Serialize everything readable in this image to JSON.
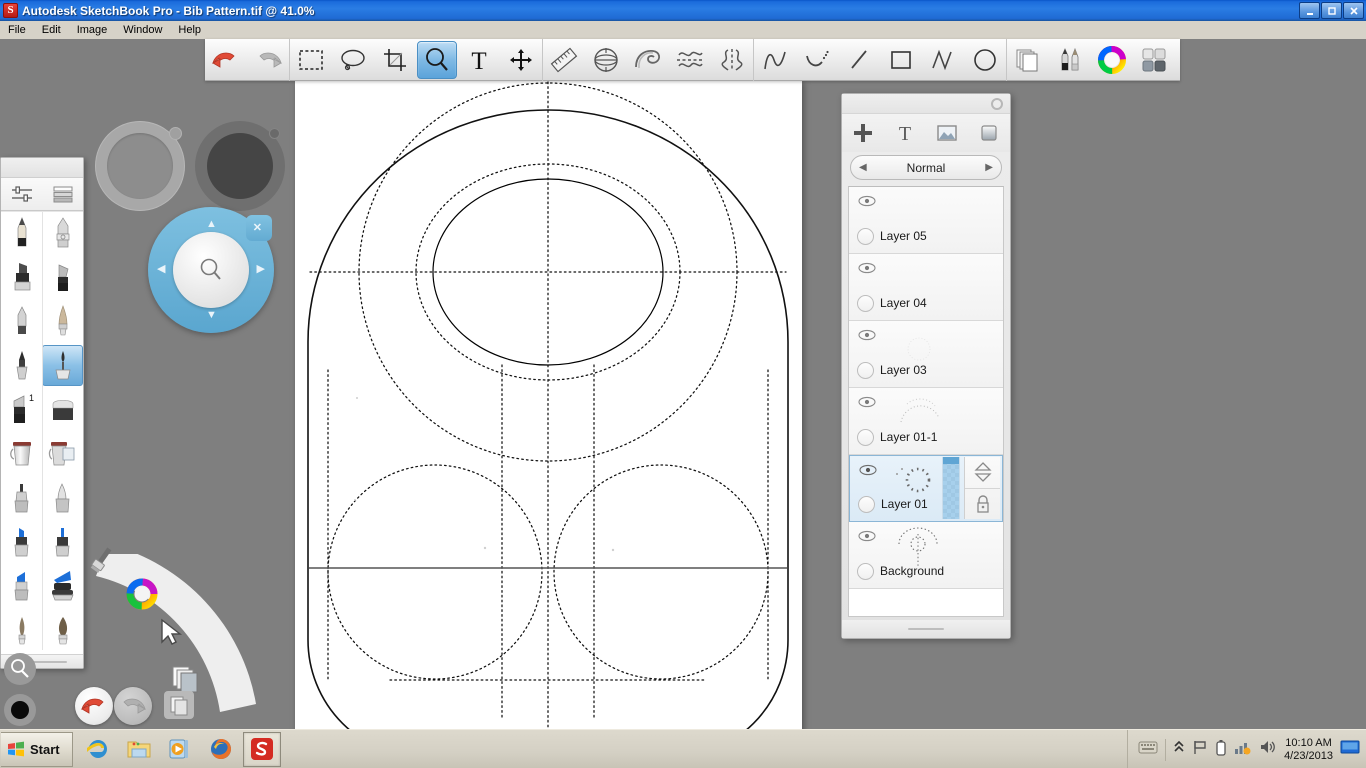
{
  "window": {
    "app_icon": "sketchbook-logo-icon",
    "title": "Autodesk SketchBook Pro - Bib Pattern.tif @ 41.0%",
    "document_name": "Bib Pattern.tif",
    "zoom_level": "41.0%",
    "minimize_label": "_",
    "maximize_label": "❐",
    "close_label": "✕"
  },
  "menubar": {
    "items": [
      {
        "label": "File"
      },
      {
        "label": "Edit"
      },
      {
        "label": "Image"
      },
      {
        "label": "Window"
      },
      {
        "label": "Help"
      }
    ]
  },
  "toolbar": {
    "groups": [
      {
        "name": "history",
        "buttons": [
          {
            "name": "undo-icon",
            "label": "Undo",
            "active": false
          },
          {
            "name": "redo-icon",
            "label": "Redo",
            "active": false
          }
        ]
      },
      {
        "name": "selection",
        "buttons": [
          {
            "name": "rectangle-select-icon",
            "label": "Rectangle Select",
            "active": false
          },
          {
            "name": "lasso-select-icon",
            "label": "Lasso Select",
            "active": false
          },
          {
            "name": "crop-icon",
            "label": "Crop",
            "active": false
          },
          {
            "name": "zoom-icon",
            "label": "Zoom",
            "active": true
          },
          {
            "name": "text-icon",
            "label": "Text",
            "active": false
          },
          {
            "name": "move-icon",
            "label": "Move",
            "active": false
          }
        ]
      },
      {
        "name": "guides",
        "buttons": [
          {
            "name": "ruler-icon",
            "label": "Ruler",
            "active": false
          },
          {
            "name": "ellipse-guide-icon",
            "label": "Ellipse Guide",
            "active": false
          },
          {
            "name": "french-curve-icon",
            "label": "French Curve",
            "active": false
          },
          {
            "name": "symmetry-x-icon",
            "label": "Symmetry X",
            "active": false
          },
          {
            "name": "symmetry-y-icon",
            "label": "Symmetry Y",
            "active": false
          }
        ]
      },
      {
        "name": "shapes",
        "buttons": [
          {
            "name": "freeform-line-icon",
            "label": "Freeform",
            "active": false
          },
          {
            "name": "curve-icon",
            "label": "Curve",
            "active": false
          },
          {
            "name": "straight-line-icon",
            "label": "Straight Line",
            "active": false
          },
          {
            "name": "rectangle-icon",
            "label": "Rectangle",
            "active": false
          },
          {
            "name": "polyline-icon",
            "label": "Polyline",
            "active": false
          },
          {
            "name": "ellipse-icon",
            "label": "Ellipse",
            "active": false
          }
        ]
      },
      {
        "name": "palettes",
        "buttons": [
          {
            "name": "layers-icon",
            "label": "Layer Editor",
            "active": false
          },
          {
            "name": "brushes-icon",
            "label": "Brush Palette",
            "active": false
          },
          {
            "name": "color-wheel-icon",
            "label": "Color Wheel",
            "active": false
          },
          {
            "name": "tool-grid-icon",
            "label": "Tool Palettes",
            "active": false
          }
        ]
      }
    ]
  },
  "brush_palette": {
    "header": [
      {
        "name": "brush-properties-icon",
        "label": "Brush Properties"
      },
      {
        "name": "brush-list-icon",
        "label": "Brush List"
      }
    ],
    "brushes": [
      {
        "name": "pencil-icon",
        "label": "Pencil",
        "selected": false
      },
      {
        "name": "marker-chisel-icon",
        "label": "Chisel Marker",
        "selected": false
      },
      {
        "name": "felt-marker-icon",
        "label": "Felt Marker",
        "selected": false
      },
      {
        "name": "flat-brush-icon",
        "label": "Flat Brush",
        "selected": false
      },
      {
        "name": "ballpoint-pen-icon",
        "label": "Ballpoint Pen",
        "selected": false
      },
      {
        "name": "soft-round-brush-icon",
        "label": "Soft Round Brush",
        "selected": false
      },
      {
        "name": "ink-pen-icon",
        "label": "Ink Pen",
        "selected": false
      },
      {
        "name": "steel-brush-icon",
        "label": "Steel Brush",
        "selected": true
      },
      {
        "name": "chisel-tip-1-icon",
        "label": "Chisel Tip 1",
        "selected": false
      },
      {
        "name": "eraser-block-icon",
        "label": "Eraser",
        "selected": false
      },
      {
        "name": "paint-bucket-icon",
        "label": "Paint Bucket",
        "selected": false
      },
      {
        "name": "paint-bucket-layer-icon",
        "label": "Fill Layer",
        "selected": false
      },
      {
        "name": "airbrush-icon",
        "label": "Airbrush",
        "selected": false
      },
      {
        "name": "soft-airbrush-icon",
        "label": "Soft Airbrush",
        "selected": false
      },
      {
        "name": "blue-marker-icon",
        "label": "Blue Marker",
        "selected": false
      },
      {
        "name": "blue-fine-marker-icon",
        "label": "Blue Fine Marker",
        "selected": false
      },
      {
        "name": "blue-chisel-marker-icon",
        "label": "Blue Chisel Marker",
        "selected": false
      },
      {
        "name": "blue-wide-marker-icon",
        "label": "Blue Wide Marker",
        "selected": false
      },
      {
        "name": "natural-brush-icon",
        "label": "Natural Brush",
        "selected": false
      },
      {
        "name": "bristle-brush-icon",
        "label": "Bristle Brush",
        "selected": false
      }
    ]
  },
  "pucks": [
    {
      "name": "brush-size-puck",
      "style": "ring"
    },
    {
      "name": "brush-opacity-puck",
      "style": "filled"
    }
  ],
  "lagoon_nav": {
    "name": "zoom-navigation-puck",
    "center_icon": "magnifier-icon",
    "up_label": "▲",
    "down_label": "▼",
    "left_label": "◀",
    "right_label": "▶",
    "close_label": "✕",
    "accent_color": "#6fb6d9"
  },
  "arc_lagoon": {
    "buttons": [
      {
        "name": "brush-tool-icon",
        "label": "Brush"
      },
      {
        "name": "color-wheel-icon",
        "label": "Color"
      },
      {
        "name": "cursor-tool-icon",
        "label": "Select"
      },
      {
        "name": "layers-tool-icon",
        "label": "Layers"
      }
    ],
    "undo": {
      "name": "undo-icon",
      "label": "Undo"
    },
    "redo": {
      "name": "redo-icon",
      "label": "Redo"
    },
    "extra": {
      "name": "copy-icon",
      "label": "Copy"
    },
    "zoom_tool": {
      "name": "magnifier-icon",
      "label": "Zoom"
    },
    "color_swatch": {
      "name": "color-swatch",
      "label": "Color",
      "color": "#000000"
    }
  },
  "layers_panel": {
    "title_close": "close-icon",
    "tools": [
      {
        "name": "add-layer-icon",
        "label": "+"
      },
      {
        "name": "add-text-layer-icon",
        "label": "T"
      },
      {
        "name": "add-image-layer-icon",
        "label": "Image"
      },
      {
        "name": "add-gradient-layer-icon",
        "label": "Gradient"
      }
    ],
    "blend_mode": {
      "prev_label": "◀",
      "value": "Normal",
      "next_label": "▶"
    },
    "layers": [
      {
        "name": "Layer 05",
        "visible": true,
        "selected": false,
        "thumb": "empty"
      },
      {
        "name": "Layer 04",
        "visible": true,
        "selected": false,
        "thumb": "empty"
      },
      {
        "name": "Layer 03",
        "visible": true,
        "selected": false,
        "thumb": "faint"
      },
      {
        "name": "Layer 01-1",
        "visible": true,
        "selected": false,
        "thumb": "dotted-arc"
      },
      {
        "name": "Layer 01",
        "visible": true,
        "selected": true,
        "thumb": "dotted-ring"
      },
      {
        "name": "Background",
        "visible": true,
        "selected": false,
        "thumb": "pattern"
      }
    ],
    "selected_layer_controls": [
      {
        "name": "layer-move-arrows-icon",
        "label": "Move Layer"
      },
      {
        "name": "layer-lock-icon",
        "label": "Lock Layer"
      }
    ]
  },
  "canvas": {
    "name": "drawing-canvas",
    "document": "Bib Pattern.tif",
    "description": "Bib sewing pattern with dotted construction guides"
  },
  "taskbar": {
    "start_label": "Start",
    "quick_launch": [
      {
        "name": "internet-explorer-icon",
        "label": "Internet Explorer",
        "active": false
      },
      {
        "name": "windows-explorer-icon",
        "label": "Windows Explorer",
        "active": false
      },
      {
        "name": "media-player-icon",
        "label": "Windows Media Player",
        "active": false
      },
      {
        "name": "firefox-icon",
        "label": "Mozilla Firefox",
        "active": false
      },
      {
        "name": "sketchbook-icon",
        "label": "Autodesk SketchBook Pro",
        "active": true
      }
    ],
    "tray": [
      {
        "name": "keyboard-icon",
        "label": "Keyboard"
      },
      {
        "name": "show-hidden-icons-icon",
        "label": "Show hidden icons"
      },
      {
        "name": "network-flag-icon",
        "label": "Network"
      },
      {
        "name": "battery-icon",
        "label": "Battery"
      },
      {
        "name": "signal-icon",
        "label": "Wireless"
      },
      {
        "name": "volume-icon",
        "label": "Volume"
      }
    ],
    "clock": {
      "time": "10:10 AM",
      "date": "4/23/2013"
    },
    "show_desktop": {
      "name": "show-desktop-icon",
      "label": "Show Desktop"
    }
  }
}
